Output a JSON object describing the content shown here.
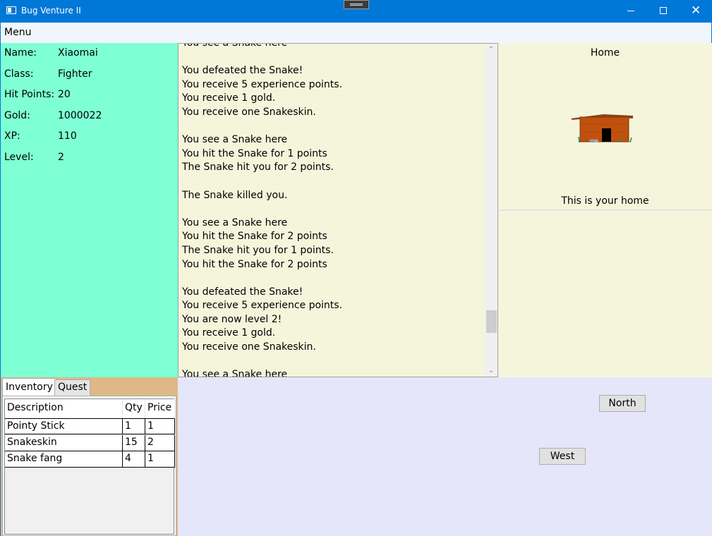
{
  "window": {
    "title": "Bug Venture II",
    "icons": {
      "app": "app-window-icon",
      "minimize": "minimize-icon",
      "maximize": "maximize-icon",
      "close": "close-icon"
    },
    "close_glyph": "✕"
  },
  "menu": {
    "items": [
      {
        "label": "Menu"
      }
    ]
  },
  "player": {
    "rows": [
      {
        "label": "Name:",
        "value": "Xiaomai"
      },
      {
        "label": "Class:",
        "value": "Fighter"
      },
      {
        "label": "Hit Points:",
        "value": "20"
      },
      {
        "label": "Gold:",
        "value": "1000022"
      },
      {
        "label": "XP:",
        "value": "110"
      },
      {
        "label": "Level:",
        "value": "2"
      }
    ]
  },
  "log": {
    "lines": [
      "You see a Snake here",
      "",
      "You defeated the Snake!",
      "You receive 5 experience points.",
      "You receive 1 gold.",
      "You receive one Snakeskin.",
      "",
      "You see a Snake here",
      "You hit the Snake for 1 points",
      "The Snake hit you for 2 points.",
      "",
      "The Snake killed you.",
      "",
      "You see a Snake here",
      "You hit the Snake for 2 points",
      "The Snake hit you for 1 points.",
      "You hit the Snake for 2 points",
      "",
      "You defeated the Snake!",
      "You receive 5 experience points.",
      "You are now level 2!",
      "You receive 1 gold.",
      "You receive one Snakeskin.",
      "",
      "You see a Snake here"
    ],
    "scroll_up_glyph": "⌃",
    "scroll_down_glyph": "⌄"
  },
  "location": {
    "name": "Home",
    "description": "This is your home",
    "image_icon": "house-image"
  },
  "inventory": {
    "tabs": [
      {
        "label": "Inventory"
      },
      {
        "label": "Quest"
      }
    ],
    "columns": [
      "Description",
      "Qty",
      "Price"
    ],
    "rows": [
      {
        "description": "Pointy Stick",
        "qty": "1",
        "price": "1"
      },
      {
        "description": "Snakeskin",
        "qty": "15",
        "price": "2"
      },
      {
        "description": "Snake fang",
        "qty": "4",
        "price": "1"
      }
    ]
  },
  "movement": {
    "north_label": "North",
    "west_label": "West"
  },
  "colors": {
    "titlebar": "#0078d7",
    "stats_bg": "#7fffd4",
    "log_bg": "#f5f5dc",
    "inventory_bg": "#deb887",
    "movement_bg": "#e6e6fa"
  }
}
